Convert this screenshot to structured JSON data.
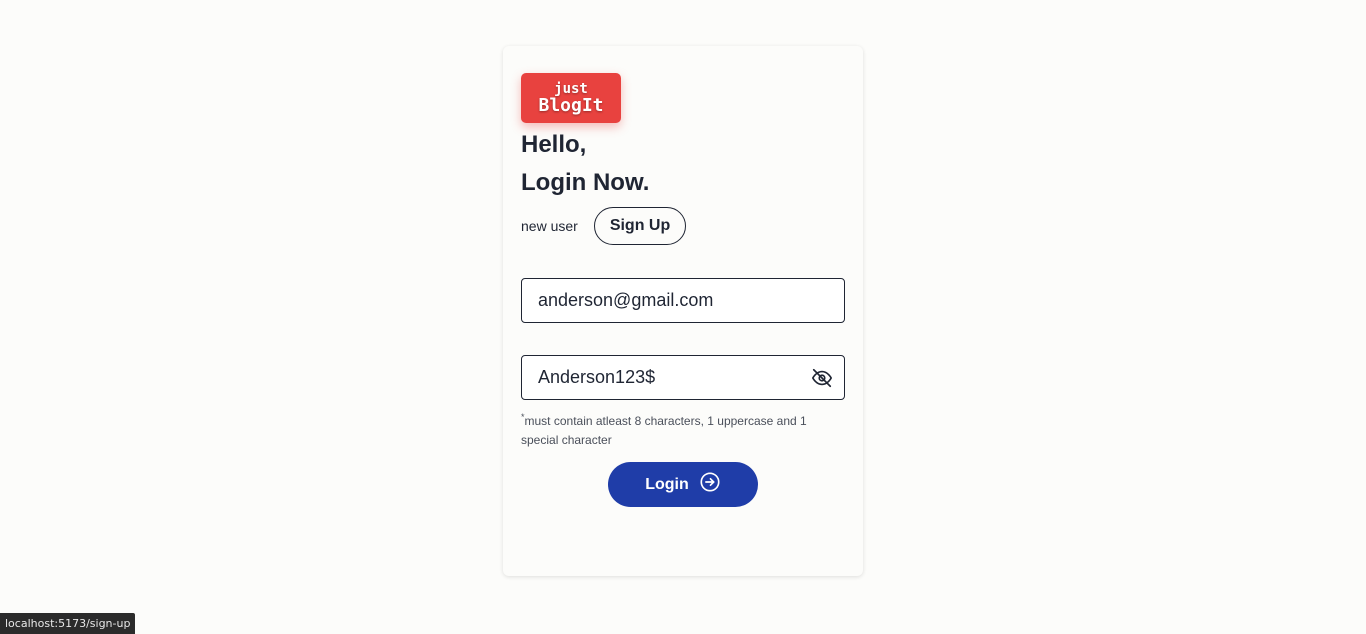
{
  "logo": {
    "line1": "just",
    "line2": "BlogIt"
  },
  "greeting": {
    "line1": "Hello,",
    "line2": "Login Now."
  },
  "signup": {
    "prompt": "new user",
    "button_label": "Sign Up"
  },
  "form": {
    "email_value": "anderson@gmail.com",
    "password_value": "Anderson123$",
    "password_hint_mark": "*",
    "password_hint": "must contain atleast 8 characters, 1 uppercase and 1 special character",
    "login_label": "Login",
    "password_toggle_icon": "eye-off-icon",
    "login_icon": "arrow-right-circle-icon"
  },
  "status_bar": {
    "url": "localhost:5173/sign-up"
  },
  "colors": {
    "logo_bg": "#e8423f",
    "primary": "#1f3da8",
    "text": "#1f2533",
    "page_bg": "#fcfcfa"
  }
}
